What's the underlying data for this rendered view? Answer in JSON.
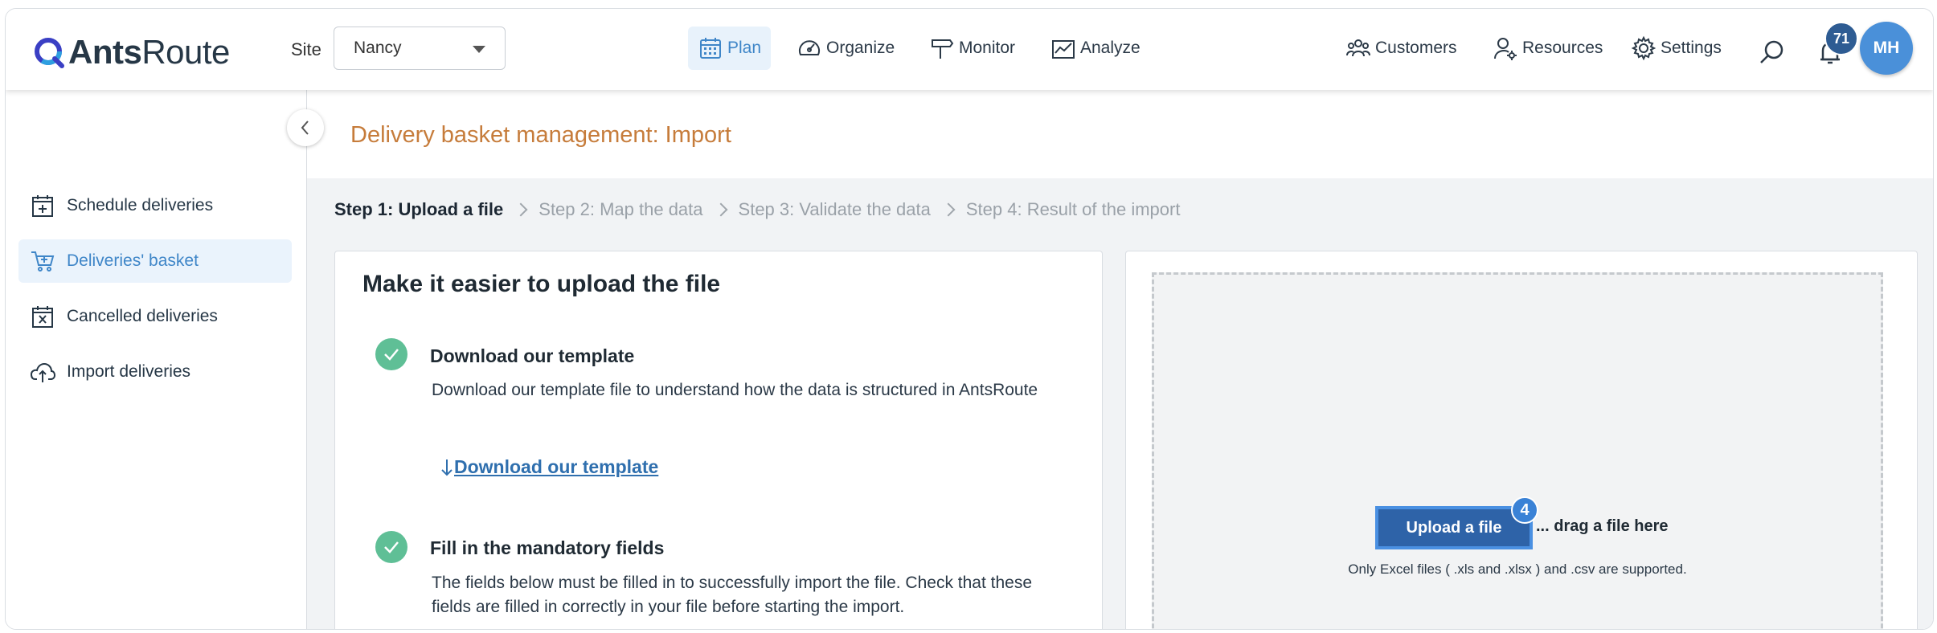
{
  "app": {
    "logo_bold": "Ants",
    "logo_light": "Route",
    "site_label": "Site",
    "site_value": "Nancy"
  },
  "nav": {
    "plan": "Plan",
    "organize": "Organize",
    "monitor": "Monitor",
    "analyze": "Analyze",
    "customers": "Customers",
    "resources": "Resources",
    "settings": "Settings",
    "notifications_count": "71",
    "avatar_initials": "MH"
  },
  "sidebar": {
    "items": [
      {
        "label": "Schedule deliveries",
        "icon": "calendar-plus-icon"
      },
      {
        "label": "Deliveries' basket",
        "icon": "basket-icon",
        "active": true
      },
      {
        "label": "Cancelled deliveries",
        "icon": "calendar-x-icon"
      },
      {
        "label": "Import deliveries",
        "icon": "cloud-upload-icon"
      }
    ]
  },
  "page": {
    "title": "Delivery basket management: Import"
  },
  "steps": [
    {
      "label": "Step 1: Upload a file",
      "active": true
    },
    {
      "label": "Step 2: Map the data"
    },
    {
      "label": "Step 3: Validate the data"
    },
    {
      "label": "Step 4: Result of the import"
    }
  ],
  "help": {
    "title": "Make it easier to upload the file",
    "sections": [
      {
        "title": "Download our template",
        "text": "Download our template file to understand how the data is structured in AntsRoute",
        "link": "Download our template"
      },
      {
        "title": "Fill in the mandatory fields",
        "text": "The fields below must be filled in to successfully import the file. Check that these fields are filled in correctly in your file before starting the import."
      }
    ]
  },
  "upload": {
    "button": "Upload a file",
    "badge": "4",
    "drag_text": "... drag a file here",
    "supported": "Only Excel files ( .xls and .xlsx ) and .csv are supported."
  },
  "colors": {
    "accent": "#3f86c8",
    "title_orange": "#c67c3b",
    "check_green": "#5fbf96",
    "primary_button": "#2e63a8"
  }
}
